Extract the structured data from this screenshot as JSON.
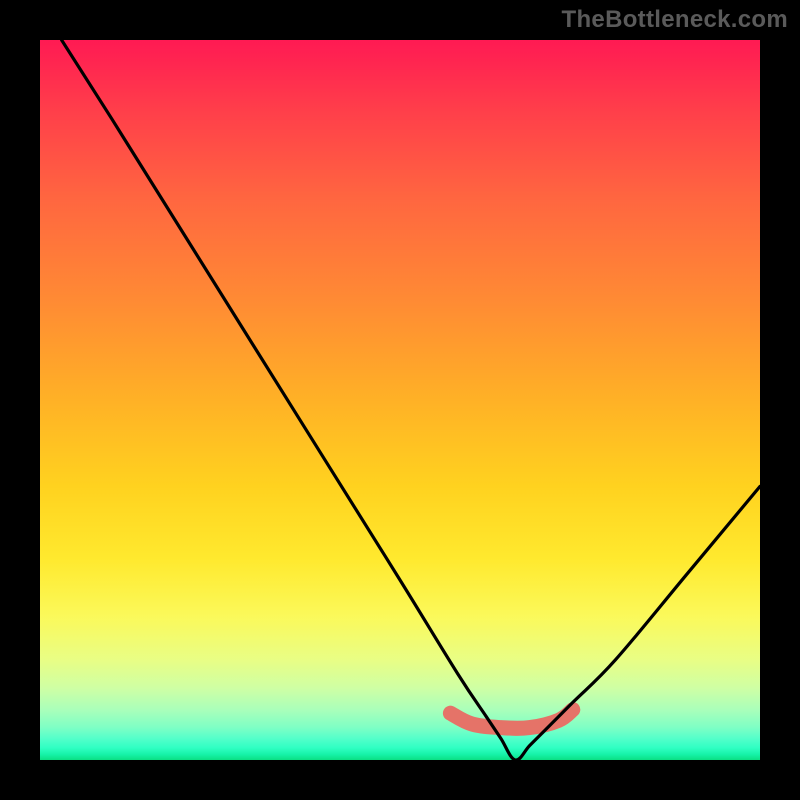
{
  "watermark": "TheBottleneck.com",
  "colors": {
    "background": "#000000",
    "gradient_top": "#ff1a53",
    "gradient_bottom": "#0adf83",
    "curve": "#000000",
    "marker": "#e57368"
  },
  "chart_data": {
    "type": "line",
    "title": "",
    "xlabel": "",
    "ylabel": "",
    "xlim": [
      0,
      100
    ],
    "ylim": [
      0,
      100
    ],
    "notes": "V-shaped bottleneck curve. Vertex (minimum) at x≈66, y≈0. Left branch descends from (~3,100) to vertex; right branch rises from vertex to (~100,38). Salmon segment highlights the optimal range along the bottom, roughly x 57–74 at y≈5.",
    "series": [
      {
        "name": "bottleneck-curve",
        "x": [
          3,
          10,
          20,
          30,
          40,
          50,
          58,
          62,
          64,
          66,
          68,
          70,
          74,
          80,
          90,
          100
        ],
        "y": [
          100,
          89,
          73,
          57,
          41,
          25,
          12,
          6,
          3,
          0,
          2,
          4,
          8,
          14,
          26,
          38
        ]
      },
      {
        "name": "optimal-range-marker",
        "x": [
          57,
          60,
          64,
          68,
          72,
          74
        ],
        "y": [
          6.5,
          5,
          4.5,
          4.5,
          5.5,
          7
        ]
      }
    ]
  }
}
